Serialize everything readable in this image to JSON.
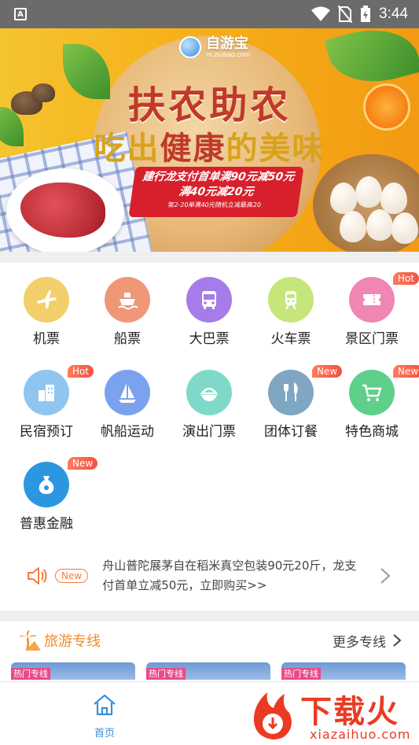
{
  "status_bar": {
    "time": "3:44",
    "app_icon": "A"
  },
  "banner": {
    "logo_name": "自游宝",
    "logo_url": "m.ziubao.com",
    "headline": "扶农助农",
    "subline_a": "吃出",
    "subline_b": "健康",
    "subline_c": "的美味",
    "promo_line1": "建行龙支付首单满90元减50元",
    "promo_line2": "满40元减20元",
    "promo_line3": "第2-20单满40元随机立减最高20"
  },
  "categories": [
    {
      "label": "机票",
      "icon": "airplane-icon",
      "color": "#f2cf6a",
      "badge": ""
    },
    {
      "label": "船票",
      "icon": "ship-icon",
      "color": "#ef9878",
      "badge": ""
    },
    {
      "label": "大巴票",
      "icon": "bus-icon",
      "color": "#a57ce9",
      "badge": ""
    },
    {
      "label": "火车票",
      "icon": "train-icon",
      "color": "#c5e67a",
      "badge": ""
    },
    {
      "label": "景区门票",
      "icon": "ticket-icon",
      "color": "#ef86b4",
      "badge": "Hot"
    },
    {
      "label": "民宿预订",
      "icon": "building-icon",
      "color": "#8fc6f0",
      "badge": "Hot"
    },
    {
      "label": "帆船运动",
      "icon": "sailboat-icon",
      "color": "#7aa2ee",
      "badge": ""
    },
    {
      "label": "演出门票",
      "icon": "show-icon",
      "color": "#7fd9c9",
      "badge": ""
    },
    {
      "label": "团体订餐",
      "icon": "dining-icon",
      "color": "#7fa6c2",
      "badge": "New"
    },
    {
      "label": "特色商城",
      "icon": "cart-icon",
      "color": "#5ed08a",
      "badge": "New"
    },
    {
      "label": "普惠金融",
      "icon": "money-bag-icon",
      "color": "#2b97e0",
      "badge": "New"
    }
  ],
  "notice": {
    "tag": "New",
    "text": "舟山普陀展茅自在稻米真空包装90元20斤，龙支付首单立减50元，立即购买>>"
  },
  "section": {
    "title": "旅游专线",
    "more": "更多专线"
  },
  "cards": [
    {
      "tag": "热门专线"
    },
    {
      "tag": "热门专线"
    },
    {
      "tag": "热门专线"
    }
  ],
  "tabbar": {
    "home_label": "首页"
  },
  "watermark": {
    "brand": "下载火",
    "url": "xiazaihuo.com"
  }
}
